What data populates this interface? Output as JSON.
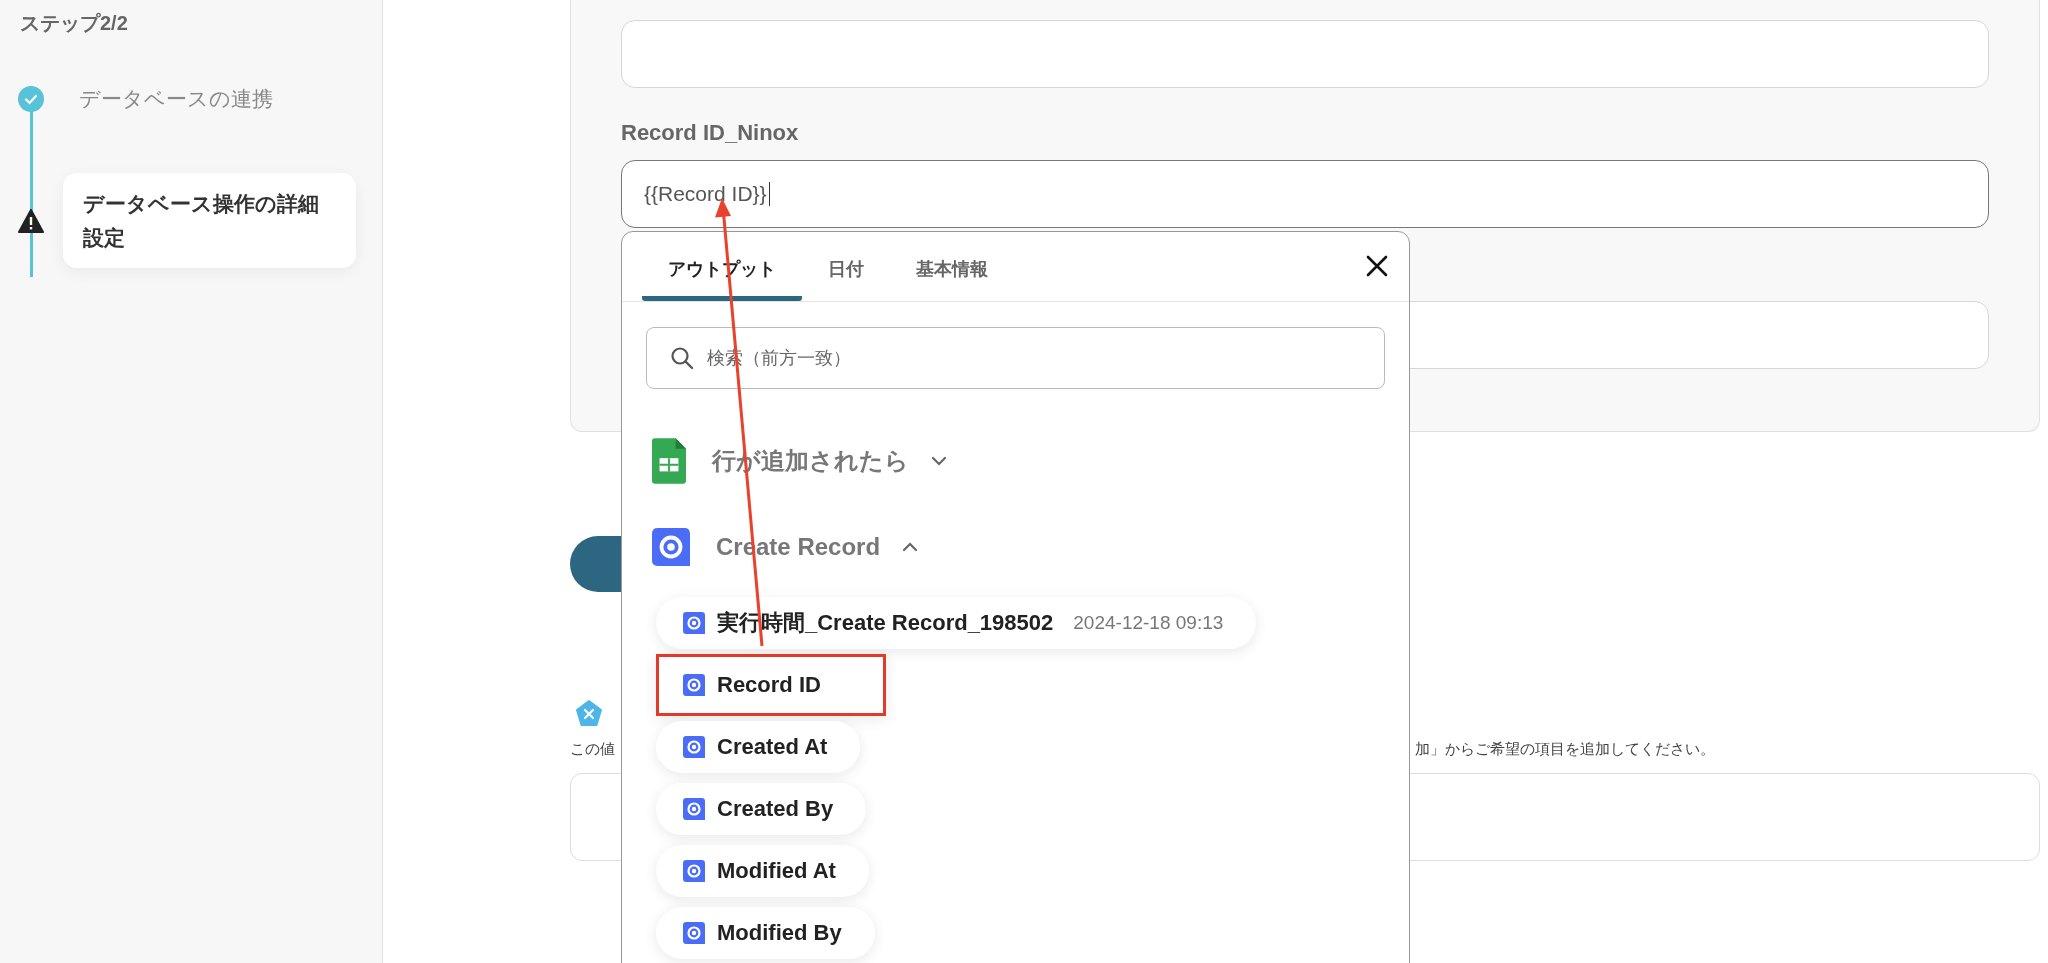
{
  "sidebar": {
    "title": "ステップ2/2",
    "steps": [
      {
        "label": "データベースの連携",
        "kind": "done",
        "selected": false
      },
      {
        "label": "データベース操作の詳細設定",
        "kind": "warning",
        "selected": true
      }
    ]
  },
  "form": {
    "fields": [
      {
        "focused": false
      },
      {
        "label": "Record ID_Ninox",
        "value": "{{Record ID}}",
        "focused": true
      },
      {
        "focused": false
      }
    ]
  },
  "description": [
    "この値",
    "加」からご希望の項目を追加してください。"
  ],
  "output_picker": {
    "tabs": [
      {
        "label": "アウトプット",
        "selected": true
      },
      {
        "label": "日付",
        "selected": false
      },
      {
        "label": "基本情報",
        "selected": false
      }
    ],
    "search": {
      "placeholder": "検索（前方一致）"
    },
    "groups": [
      {
        "kind": "sheet",
        "title": "行が追加されたら",
        "expanded": false
      },
      {
        "kind": "ninox",
        "title": "Create Record",
        "expanded": true,
        "items": [
          {
            "label": "実行時間_Create Record_198502",
            "value": "2024-12-18 09:13",
            "highlighted": false
          },
          {
            "label": "Record ID",
            "highlighted": true
          },
          {
            "label": "Created At",
            "highlighted": false
          },
          {
            "label": "Created By",
            "highlighted": false
          },
          {
            "label": "Modified At",
            "highlighted": false
          },
          {
            "label": "Modified By",
            "highlighted": false
          }
        ]
      }
    ]
  }
}
